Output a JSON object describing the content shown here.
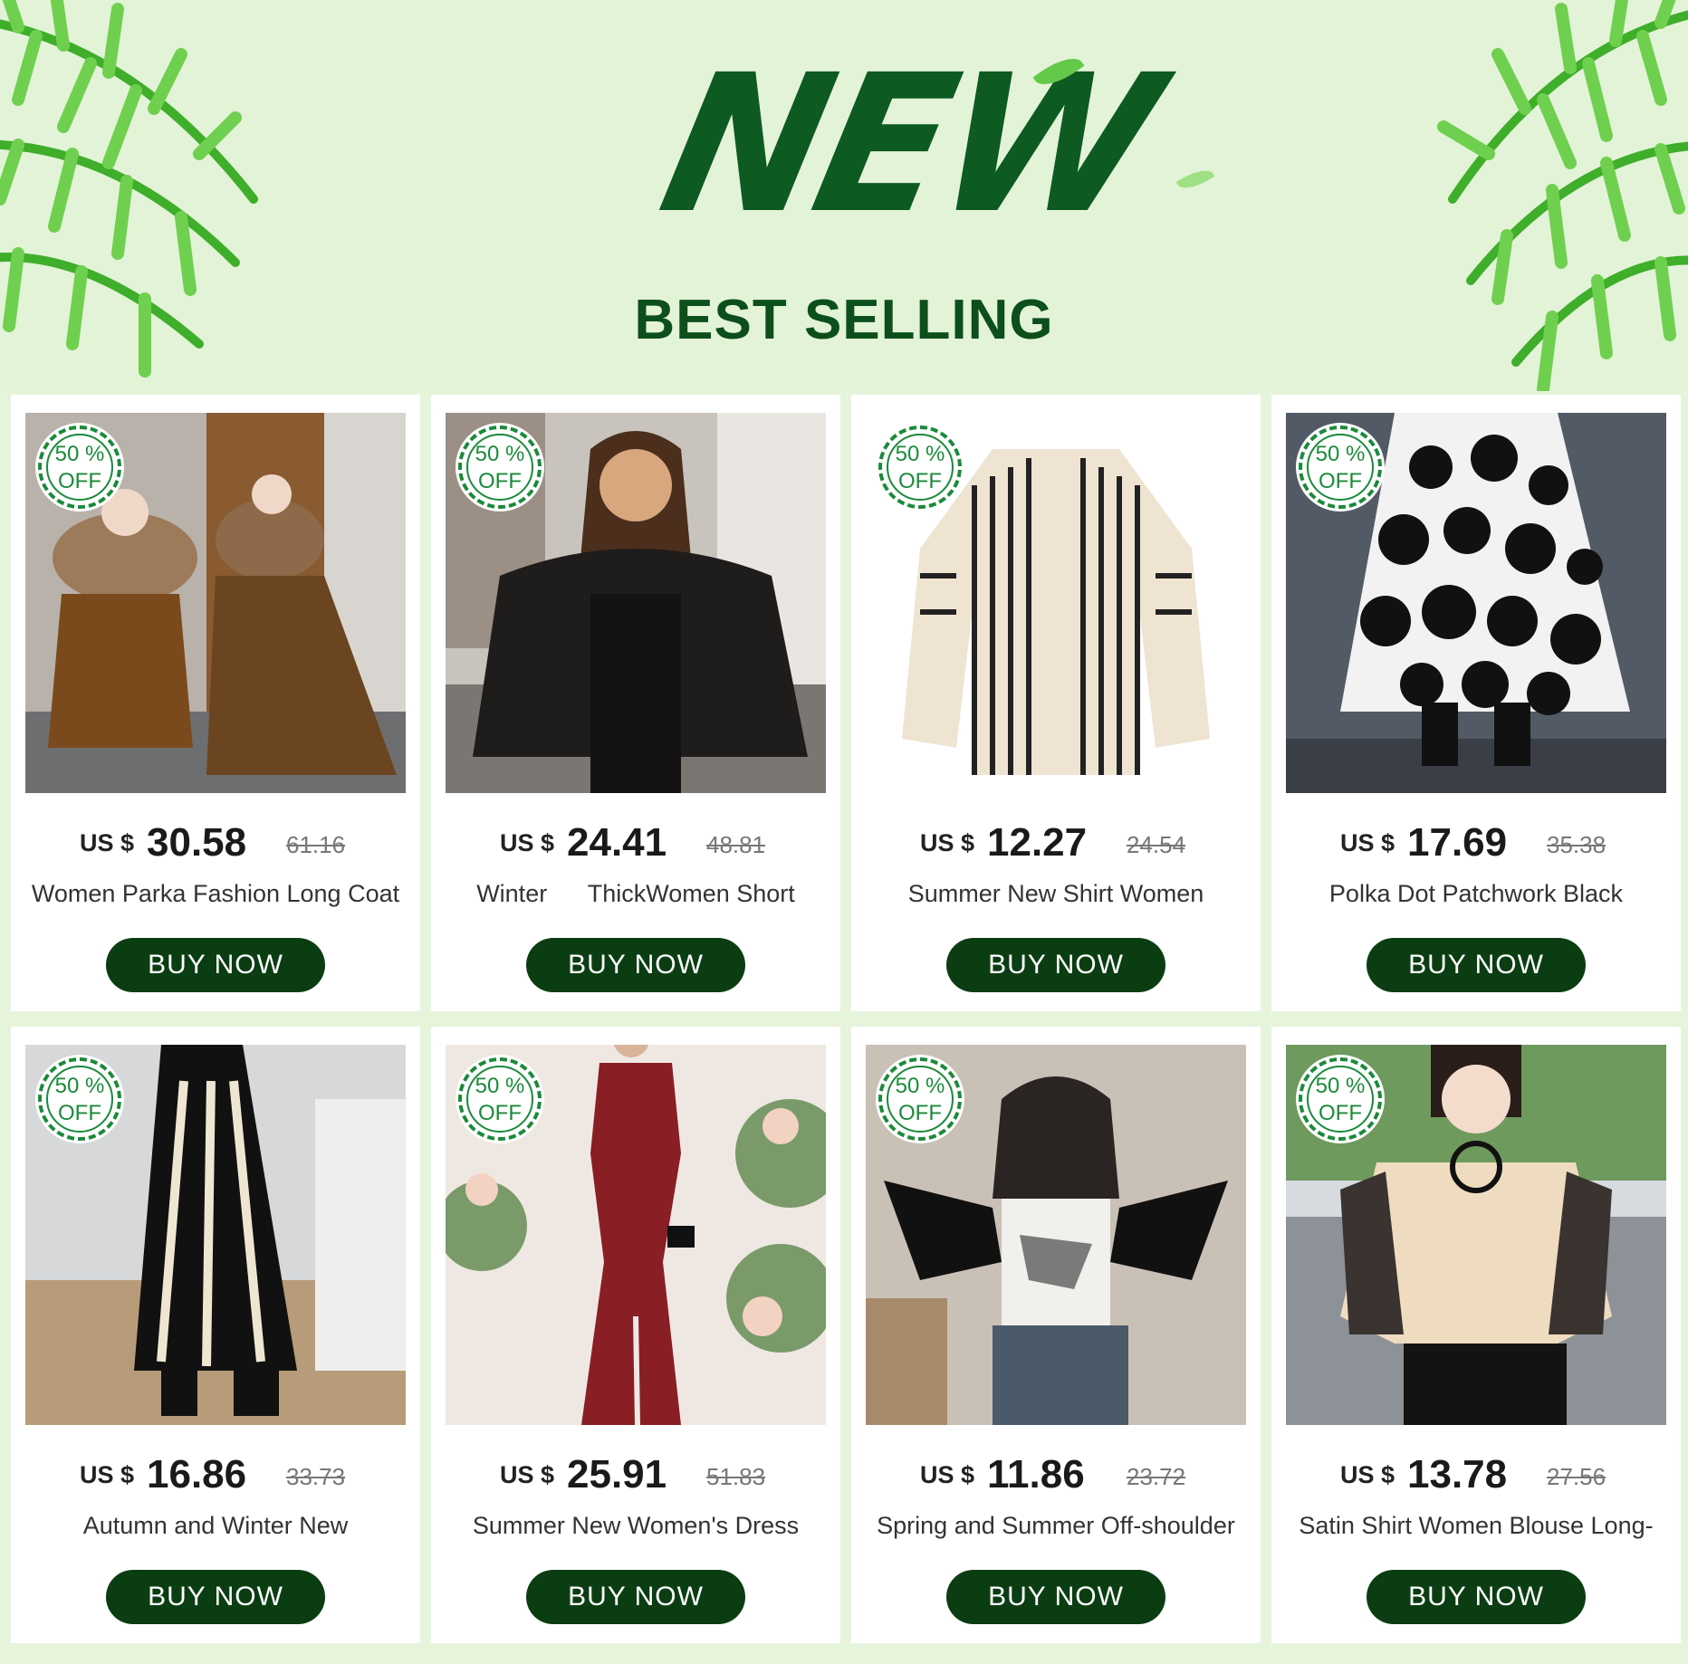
{
  "header": {
    "logo_text": "NEW",
    "subtitle": "BEST SELLING"
  },
  "colors": {
    "brand_green": "#0c4f1c",
    "button_bg": "#0b3d12",
    "badge_green": "#1b8a3a",
    "background": "#e6f4dc"
  },
  "products": [
    {
      "badge_pct": "50 %",
      "badge_off": "OFF",
      "currency": "US $",
      "price": "30.58",
      "old_price": "61.16",
      "title": "Women Parka Fashion Long Coat",
      "button": "BUY NOW"
    },
    {
      "badge_pct": "50 %",
      "badge_off": "OFF",
      "currency": "US $",
      "price": "24.41",
      "old_price": "48.81",
      "title": "Winter      ThickWomen Short",
      "button": "BUY NOW"
    },
    {
      "badge_pct": "50 %",
      "badge_off": "OFF",
      "currency": "US $",
      "price": "12.27",
      "old_price": "24.54",
      "title": "Summer New Shirt Women",
      "button": "BUY NOW"
    },
    {
      "badge_pct": "50 %",
      "badge_off": "OFF",
      "currency": "US $",
      "price": "17.69",
      "old_price": "35.38",
      "title": "Polka Dot Patchwork Black",
      "button": "BUY NOW"
    },
    {
      "badge_pct": "50 %",
      "badge_off": "OFF",
      "currency": "US $",
      "price": "16.86",
      "old_price": "33.73",
      "title": "Autumn and Winter New",
      "button": "BUY NOW"
    },
    {
      "badge_pct": "50 %",
      "badge_off": "OFF",
      "currency": "US $",
      "price": "25.91",
      "old_price": "51.83",
      "title": "Summer New Women's Dress",
      "button": "BUY NOW"
    },
    {
      "badge_pct": "50 %",
      "badge_off": "OFF",
      "currency": "US $",
      "price": "11.86",
      "old_price": "23.72",
      "title": "Spring and Summer Off-shoulder",
      "button": "BUY NOW"
    },
    {
      "badge_pct": "50 %",
      "badge_off": "OFF",
      "currency": "US $",
      "price": "13.78",
      "old_price": "27.56",
      "title": "Satin Shirt Women Blouse Long-",
      "button": "BUY NOW"
    }
  ]
}
